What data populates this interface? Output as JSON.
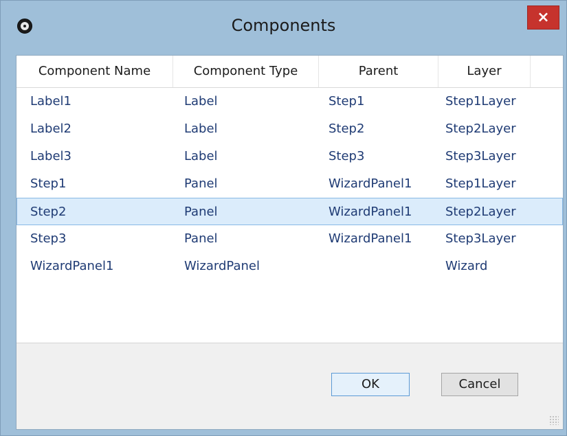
{
  "window": {
    "title": "Components",
    "close_label": "×"
  },
  "table": {
    "columns": [
      "Component Name",
      "Component Type",
      "Parent",
      "Layer"
    ],
    "rows": [
      [
        "Label1",
        "Label",
        "Step1",
        "Step1Layer"
      ],
      [
        "Label2",
        "Label",
        "Step2",
        "Step2Layer"
      ],
      [
        "Label3",
        "Label",
        "Step3",
        "Step3Layer"
      ],
      [
        "Step1",
        "Panel",
        "WizardPanel1",
        "Step1Layer"
      ],
      [
        "Step2",
        "Panel",
        "WizardPanel1",
        "Step2Layer"
      ],
      [
        "Step3",
        "Panel",
        "WizardPanel1",
        "Step3Layer"
      ],
      [
        "WizardPanel1",
        "WizardPanel",
        "",
        "Wizard"
      ]
    ],
    "selected_row": 4
  },
  "buttons": {
    "ok": "OK",
    "cancel": "Cancel"
  },
  "icons": {
    "app": "app-icon",
    "close": "close-icon",
    "resize": "resize-grip-icon"
  },
  "colors": {
    "selection": "#dbecfb",
    "text": "#1f3b74",
    "close": "#c6332d"
  }
}
